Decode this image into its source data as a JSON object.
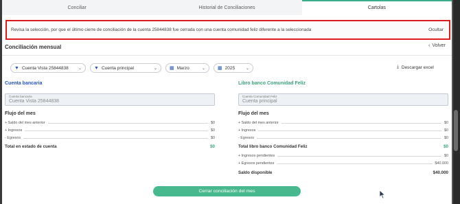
{
  "tabs": [
    {
      "label": "Conciliar"
    },
    {
      "label": "Historial de Conciliaciones"
    },
    {
      "label": "Cartolas"
    }
  ],
  "active_tab": "Cartolas",
  "alert": {
    "message": "Revisa la selección, por que el último cierre de conciliación de la cuenta 25844838 fue cerrada con una cuenta comunidad feliz diferente a la seleccionada",
    "close_label": "Ocultar"
  },
  "page": {
    "title": "Conciliación mensual",
    "back_label": "Volver"
  },
  "filters": {
    "account": "Cuenta Vista 25844838",
    "ledger": "Cuenta principal",
    "month": "Marzo",
    "year": "2025",
    "download_label": "Descargar excel"
  },
  "bank": {
    "section_title": "Cuenta bancaria",
    "field_label": "Cuenta bancaria",
    "field_value": "Cuenta Vista 25844838",
    "flow_title": "Flujo del mes",
    "rows": [
      {
        "label": "+ Saldo del mes anterior",
        "amount": "$0"
      },
      {
        "label": "+ Ingresos",
        "amount": "$0"
      },
      {
        "label": "- Egresos",
        "amount": "$0"
      }
    ],
    "total_label": "Total en estado de cuenta",
    "total_amount": "$0"
  },
  "book": {
    "section_title": "Libro banco Comunidad Feliz",
    "field_label": "Cuenta Comunidad Feliz",
    "field_value": "Cuenta principal",
    "flow_title": "Flujo del mes",
    "rows": [
      {
        "label": "+ Saldo del mes anterior",
        "amount": "$0"
      },
      {
        "label": "+ Ingresos",
        "amount": "$0"
      },
      {
        "label": "- Egresos",
        "amount": "$0"
      }
    ],
    "total_label": "Total libro banco Comunidad Feliz",
    "total_amount": "$0",
    "pending_rows": [
      {
        "label": "+ Ingresos pendientes",
        "amount": "$0"
      },
      {
        "label": "+ Egresos pendientes",
        "amount": "$40.000"
      }
    ],
    "balance_label": "Saldo disponible",
    "balance_amount": "$40.000"
  },
  "actions": {
    "close_month_label": "Cerrar conciliación del mes"
  },
  "colors": {
    "accent_green": "#48b98f",
    "link_blue": "#2556b8",
    "alert_border": "#e01b1b"
  }
}
